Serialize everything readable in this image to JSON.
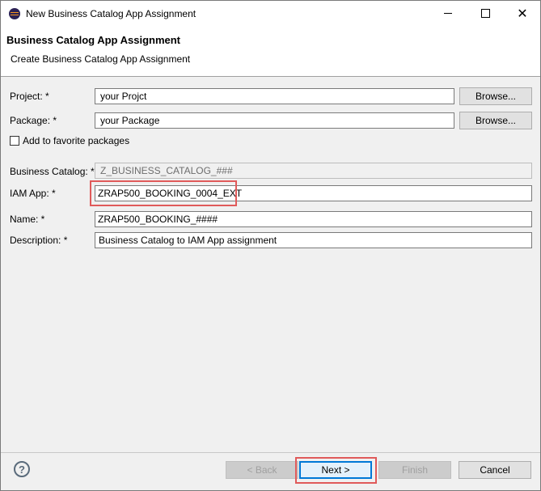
{
  "window": {
    "title": "New Business Catalog App Assignment",
    "close_glyph": "✕"
  },
  "header": {
    "title": "Business Catalog App Assignment",
    "subtitle": "Create Business Catalog App Assignment"
  },
  "form": {
    "project": {
      "label": "Project: *",
      "value": "your Projct"
    },
    "package": {
      "label": "Package: *",
      "value": "your Package"
    },
    "favorite": {
      "label": "Add to favorite packages",
      "checked": false
    },
    "business_catalog": {
      "label": "Business Catalog: *",
      "value": "Z_BUSINESS_CATALOG_###"
    },
    "iam_app": {
      "label": "IAM App: *",
      "value": "ZRAP500_BOOKING_0004_EXT"
    },
    "name": {
      "label": "Name: *",
      "value": "ZRAP500_BOOKING_####"
    },
    "description": {
      "label": "Description: *",
      "value": "Business Catalog to IAM App assignment"
    },
    "browse_label": "Browse..."
  },
  "footer": {
    "help": "?",
    "back": "< Back",
    "next": "Next >",
    "finish": "Finish",
    "cancel": "Cancel"
  },
  "colors": {
    "highlight": "#e05a5a",
    "accent": "#0078d7"
  }
}
